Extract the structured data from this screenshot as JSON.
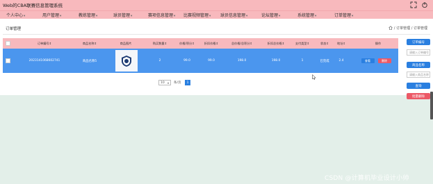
{
  "app": {
    "title": "Web的CBA联赛信息管理系统"
  },
  "nav": {
    "items": [
      {
        "label": "个人中心"
      },
      {
        "label": "用户管理"
      },
      {
        "label": "教练管理"
      },
      {
        "label": "球员管理"
      },
      {
        "label": "赛项信息管理"
      },
      {
        "label": "比赛视频管理"
      },
      {
        "label": "球员信息管理"
      },
      {
        "label": "论坛管理"
      },
      {
        "label": "系统管理"
      },
      {
        "label": "订单管理"
      }
    ]
  },
  "page": {
    "title": "订单管理",
    "breadcrumb": [
      "订单管理",
      "订单管理"
    ]
  },
  "table": {
    "headers": [
      "订单编号",
      "商品名称",
      "商品图片",
      "购买数量",
      "价格/积分",
      "折扣价格",
      "总价格/总积分",
      "折扣总价格",
      "支付类型",
      "状态",
      "地址",
      "操作"
    ],
    "rows": [
      {
        "order_no": "2023141068602741",
        "product_name": "商品名称5",
        "quantity": "2",
        "price": "99.0",
        "discount_price": "99.0",
        "total_price": "198.0",
        "discount_total": "198.0",
        "pay_type": "1",
        "status": "已完成",
        "address": "2.4",
        "view_label": "查看",
        "delete_label": "删除"
      }
    ]
  },
  "pagination": {
    "page_size": "10",
    "size_label": "条/页",
    "current_page": "1"
  },
  "sidebar": {
    "order_no_button": "订单编号",
    "order_no_placeholder": "请输入订单编号",
    "product_name_button": "商品名称",
    "product_name_placeholder": "请输入商品名称",
    "search_button": "查询",
    "batch_delete_button": "批量删除"
  },
  "watermark": "CSDN @计算机毕业设计小帅",
  "colors": {
    "header": "#f8b9bd",
    "row_selected": "#4b96ee",
    "primary": "#2a7fe0",
    "danger": "#ec5966"
  }
}
